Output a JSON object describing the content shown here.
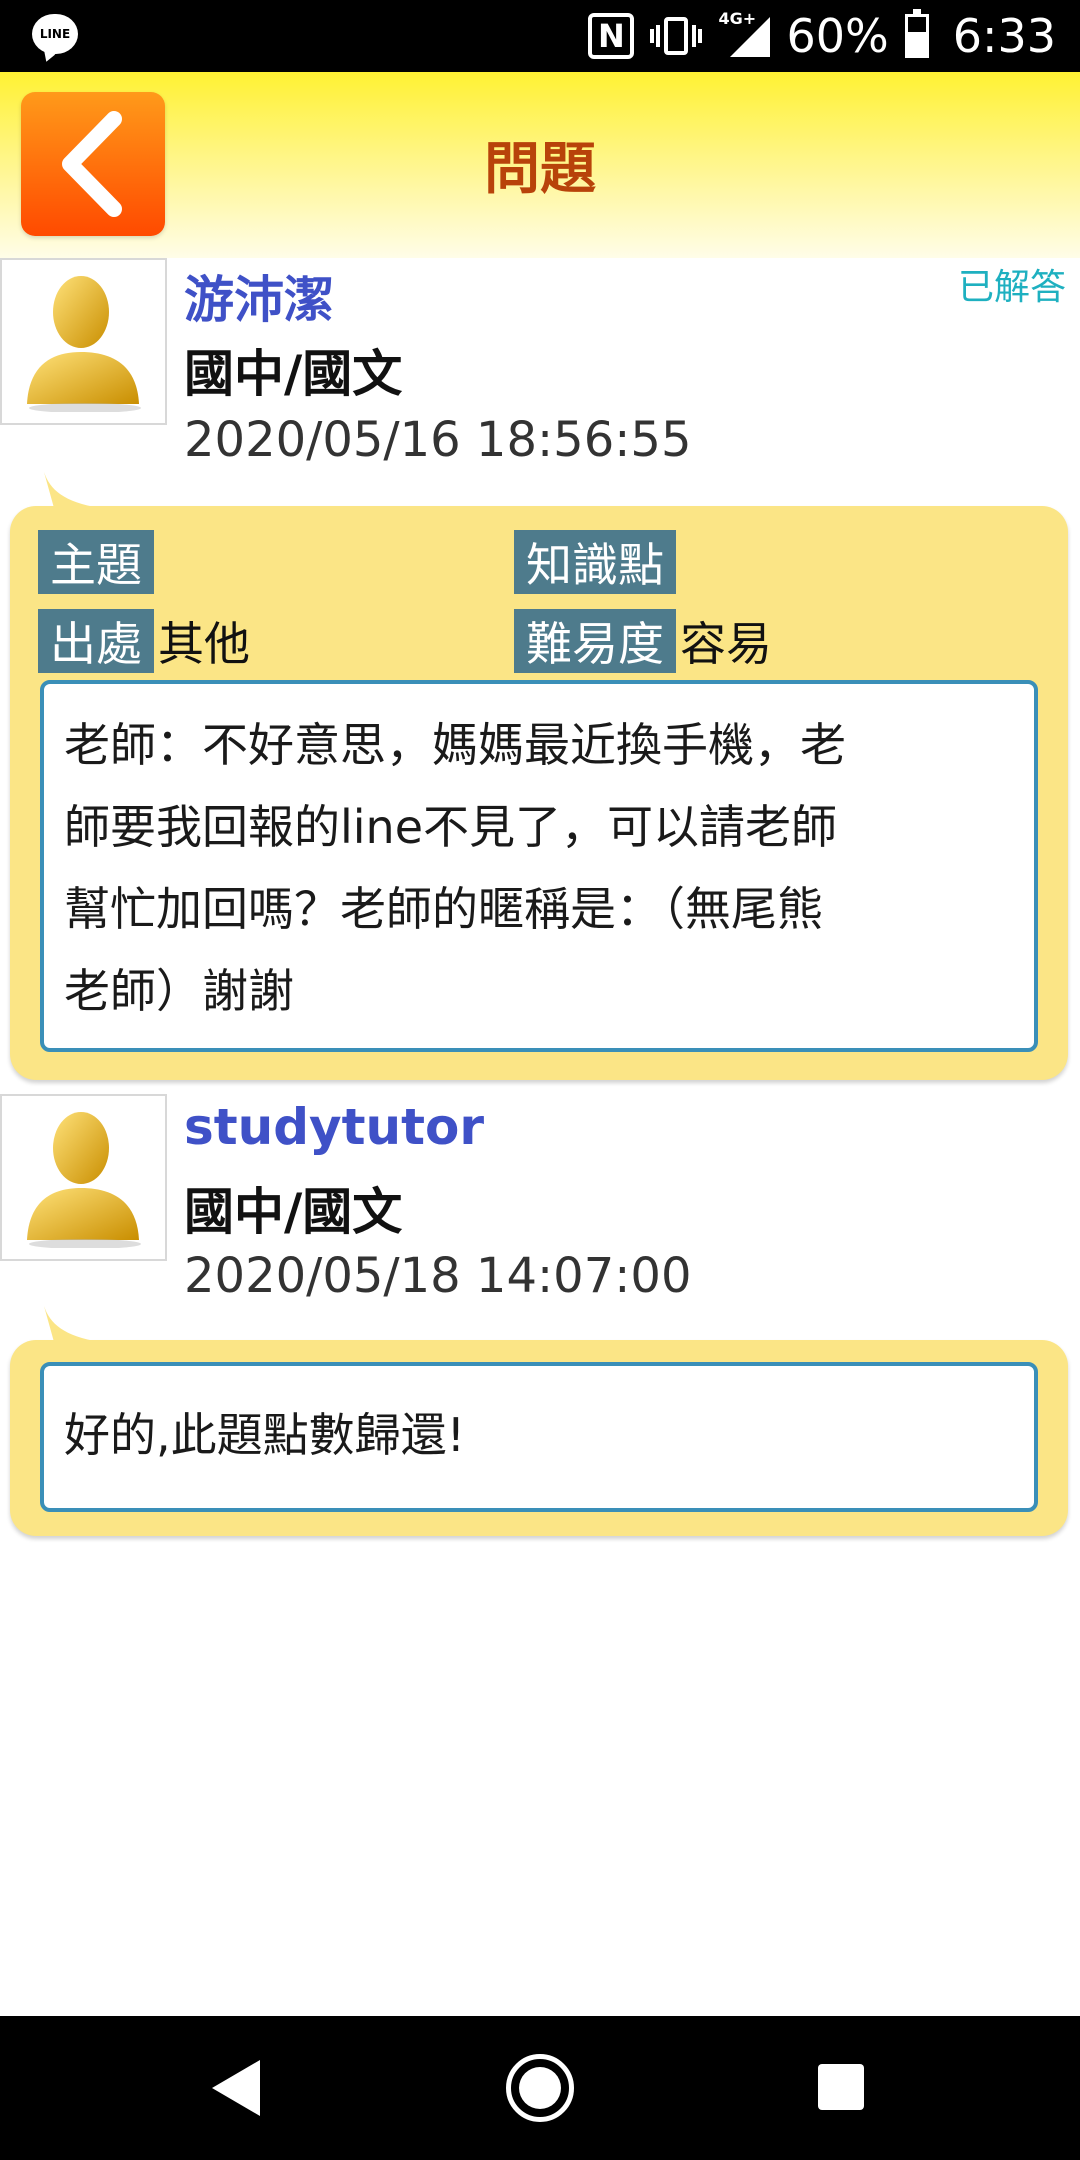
{
  "status_bar": {
    "app_icon": "line-app-icon",
    "app_icon_text": "LINE",
    "nfc_text": "N",
    "network_type": "4G+",
    "battery_percent": "60%",
    "battery_level": 0.6,
    "time": "6:33"
  },
  "header": {
    "title": "問題",
    "back_icon": "chevron-left-icon"
  },
  "question": {
    "user_name": "游沛潔",
    "subject": "國中/國文",
    "timestamp": "2020/05/16 18:56:55",
    "status_badge": "已解答",
    "meta": {
      "topic_label": "主題",
      "topic_value": "",
      "knowledge_label": "知識點",
      "knowledge_value": "",
      "source_label": "出處",
      "source_value": "其他",
      "difficulty_label": "難易度",
      "difficulty_value": "容易"
    },
    "content_lines": [
      "老師：不好意思，媽媽最近換手機，老",
      "師要我回報的line不見了，可以請老師",
      "幫忙加回嗎？老師的暱稱是：（無尾熊",
      "老師）謝謝"
    ]
  },
  "answer": {
    "user_name": "studytutor",
    "subject": "國中/國文",
    "timestamp": "2020/05/18 14:07:00",
    "content": "好的,此題點數歸還!"
  },
  "colors": {
    "header_gradient_top": "#fff133",
    "back_button": "#ff6a00",
    "title": "#b8430a",
    "user_name": "#3f51c7",
    "answered": "#1eb0c0",
    "bubble": "#fbe586",
    "meta_label_bg": "#4e7b8c",
    "content_border": "#3a8fb8"
  },
  "nav_bar": {
    "back_icon": "triangle-back-icon",
    "home_icon": "circle-home-icon",
    "recents_icon": "square-recents-icon"
  }
}
